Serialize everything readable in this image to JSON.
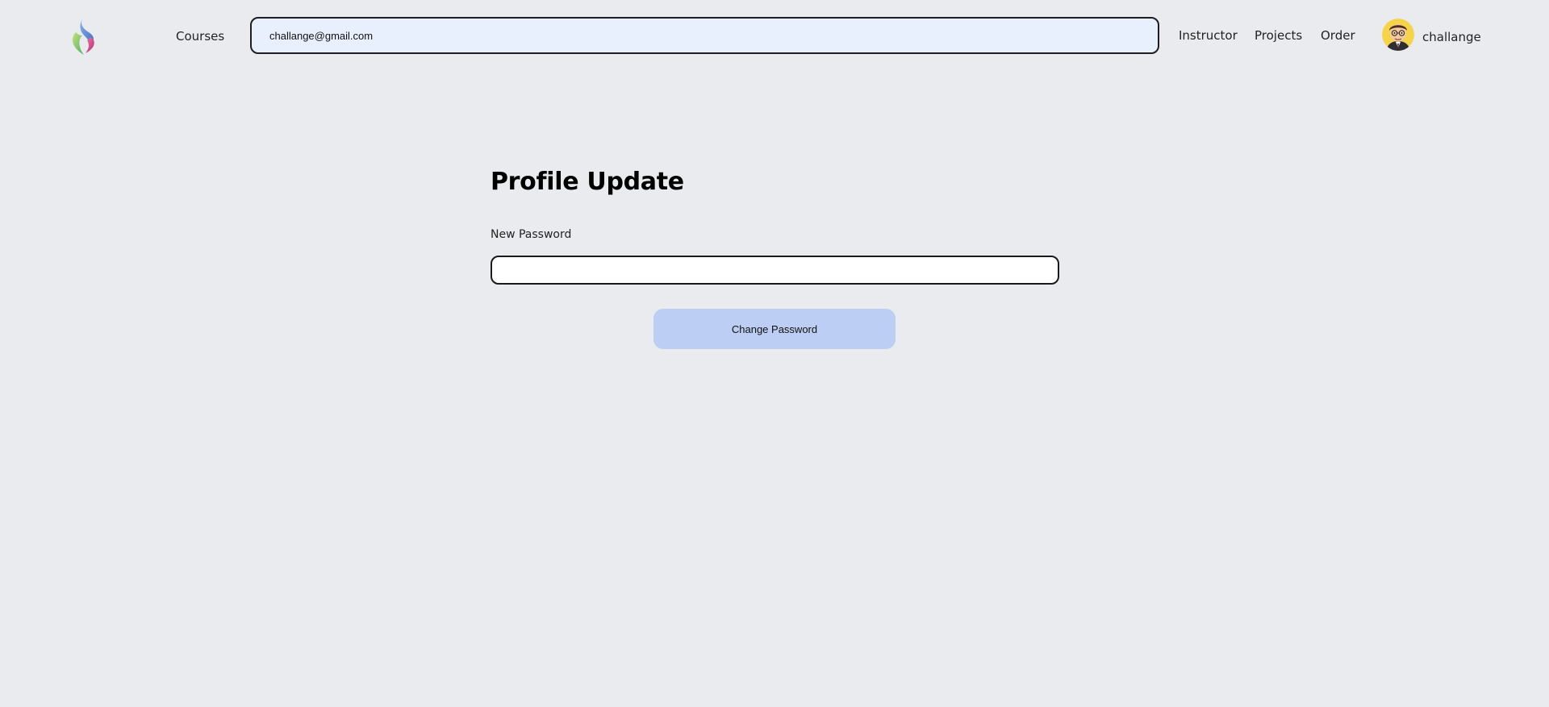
{
  "header": {
    "logo_icon": "brand-flame-logo-icon",
    "nav": {
      "courses": "Courses",
      "instructor": "Instructor",
      "projects": "Projects",
      "order": "Order"
    },
    "search": {
      "value": "challange@gmail.com",
      "placeholder": ""
    },
    "user": {
      "name": "challange",
      "avatar_icon": "cartoon-avatar-icon"
    }
  },
  "main": {
    "title": "Profile Update",
    "password_label": "New Password",
    "password_value": "",
    "submit_label": "Change Password"
  },
  "colors": {
    "background": "#eaebef",
    "search_fill": "#e8f0fe",
    "button_fill": "#bccef3",
    "border": "#1e1e1e"
  }
}
